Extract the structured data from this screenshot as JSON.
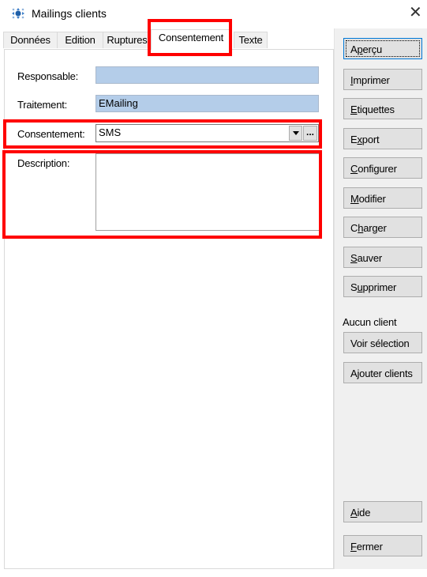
{
  "window": {
    "title": "Mailings clients",
    "app_icon": "app-logo-icon",
    "close_icon": "close-icon"
  },
  "tabs": [
    {
      "label": "Données",
      "active": false
    },
    {
      "label": "Edition",
      "active": false
    },
    {
      "label": "Ruptures",
      "active": false
    },
    {
      "label": "Consentement",
      "active": true
    },
    {
      "label": "Texte",
      "active": false
    }
  ],
  "form": {
    "responsable": {
      "label": "Responsable:",
      "value": ""
    },
    "traitement": {
      "label": "Traitement:",
      "value": "EMailing"
    },
    "consentement": {
      "label": "Consentement:",
      "value": "SMS",
      "ellipsis": "..."
    },
    "description": {
      "label": "Description:",
      "value": ""
    }
  },
  "buttons": {
    "apercu": {
      "pre": "A",
      "key": "p",
      "post": "erçu"
    },
    "imprimer": {
      "pre": "",
      "key": "I",
      "post": "mprimer"
    },
    "etiquettes": {
      "pre": "",
      "key": "E",
      "post": "tiquettes"
    },
    "export": {
      "pre": "E",
      "key": "x",
      "post": "port"
    },
    "configurer": {
      "pre": "",
      "key": "C",
      "post": "onfigurer"
    },
    "modifier": {
      "pre": "",
      "key": "M",
      "post": "odifier"
    },
    "charger": {
      "pre": "C",
      "key": "h",
      "post": "arger"
    },
    "sauver": {
      "pre": "",
      "key": "S",
      "post": "auver"
    },
    "supprimer": {
      "pre": "S",
      "key": "u",
      "post": "pprimer"
    },
    "voir_selection": {
      "label": "Voir sélection"
    },
    "ajouter_clients": {
      "label": "Ajouter clients"
    },
    "aide": {
      "pre": "",
      "key": "A",
      "post": "ide"
    },
    "fermer": {
      "pre": "",
      "key": "F",
      "post": "ermer"
    }
  },
  "selection_status": "Aucun client",
  "highlight_color": "#ff0000"
}
